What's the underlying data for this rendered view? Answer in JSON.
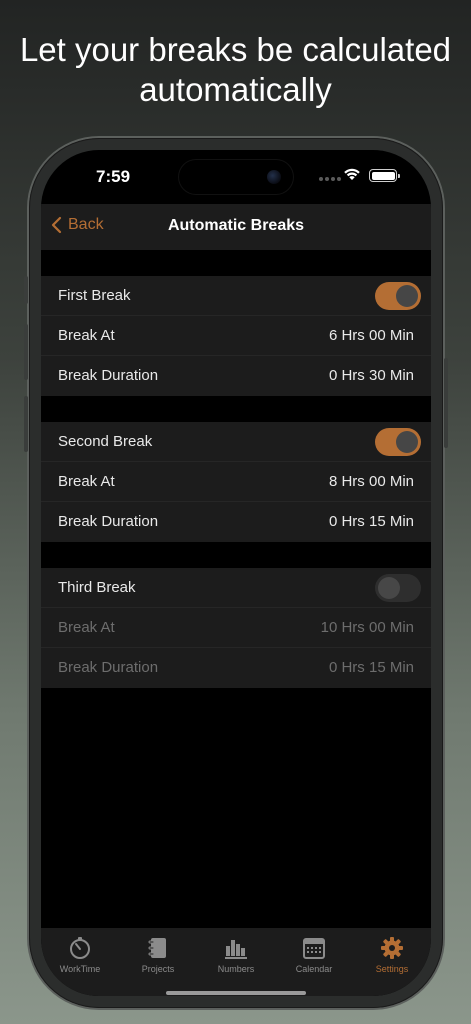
{
  "headline": "Let your breaks be calculated automatically",
  "status_bar": {
    "time": "7:59"
  },
  "nav": {
    "back_label": "Back",
    "title": "Automatic Breaks"
  },
  "breaks": [
    {
      "name": "First Break",
      "enabled": true,
      "break_at_label": "Break At",
      "break_at": "6 Hrs 00 Min",
      "duration_label": "Break Duration",
      "duration": "0 Hrs 30 Min"
    },
    {
      "name": "Second Break",
      "enabled": true,
      "break_at_label": "Break At",
      "break_at": "8 Hrs 00 Min",
      "duration_label": "Break Duration",
      "duration": "0 Hrs 15 Min"
    },
    {
      "name": "Third Break",
      "enabled": false,
      "break_at_label": "Break At",
      "break_at": "10 Hrs 00 Min",
      "duration_label": "Break Duration",
      "duration": "0 Hrs 15 Min"
    }
  ],
  "tabs": [
    {
      "label": "WorkTime",
      "icon": "stopwatch-icon",
      "active": false
    },
    {
      "label": "Projects",
      "icon": "notebook-icon",
      "active": false
    },
    {
      "label": "Numbers",
      "icon": "bar-chart-icon",
      "active": false
    },
    {
      "label": "Calendar",
      "icon": "calendar-icon",
      "active": false
    },
    {
      "label": "Settings",
      "icon": "gear-icon",
      "active": true
    }
  ],
  "colors": {
    "accent": "#b46e34",
    "group_bg": "#1c1c1c",
    "tab_inactive": "#8b8b8b"
  }
}
